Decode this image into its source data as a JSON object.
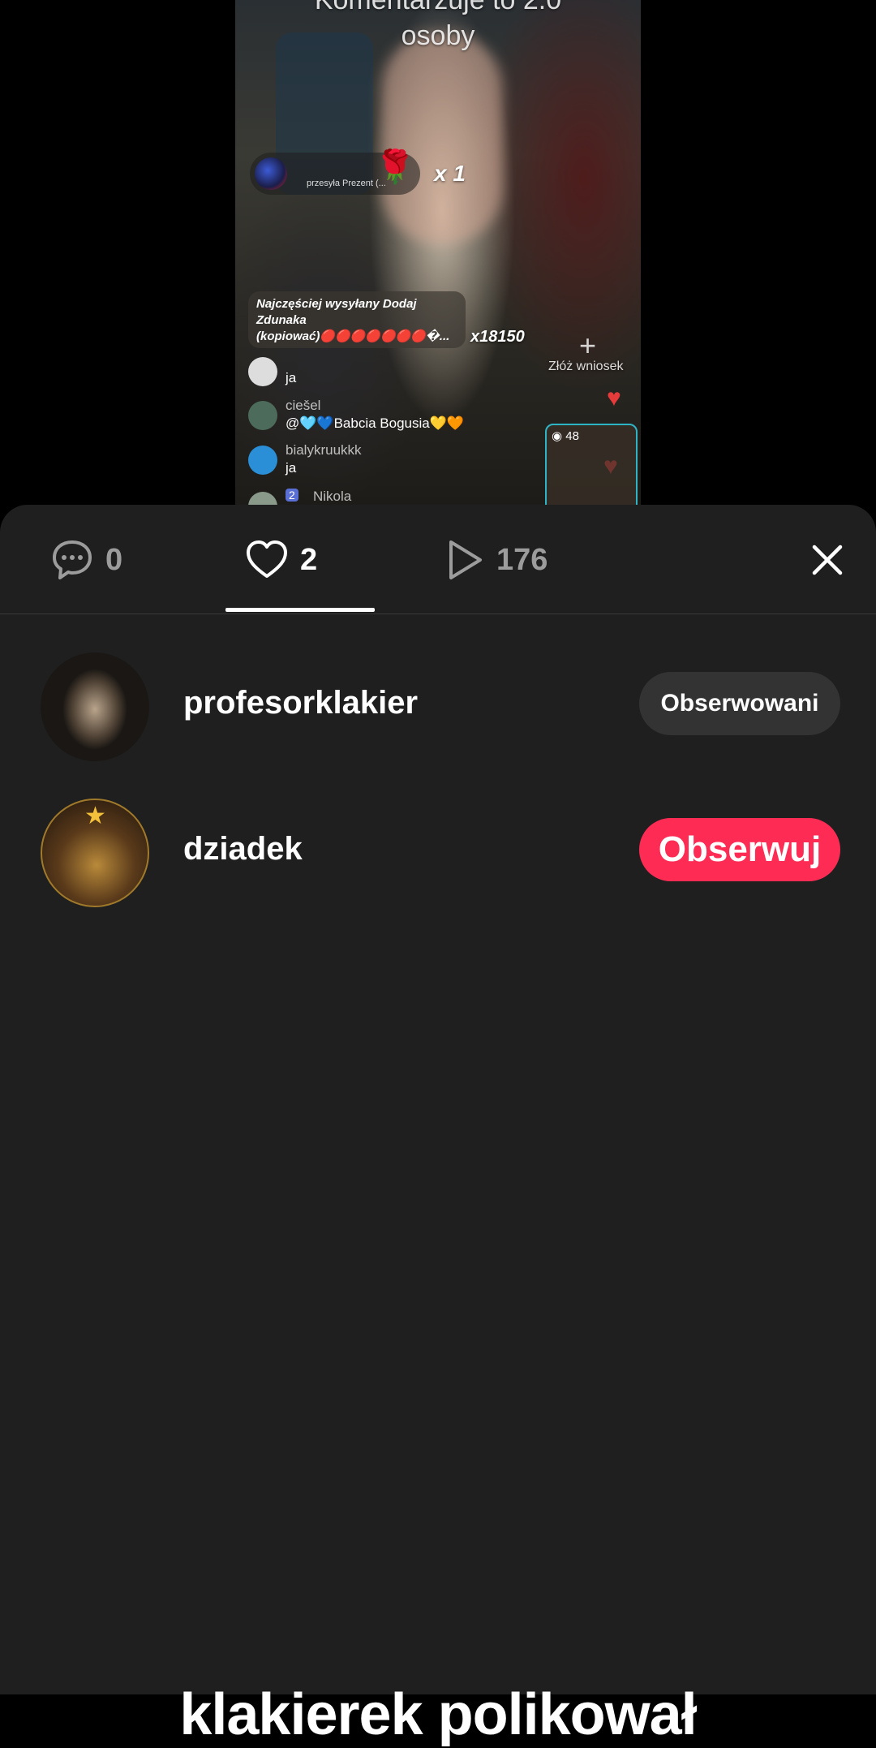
{
  "video": {
    "caption_top": "Komentarzuje to 2.0\nosoby",
    "gift": {
      "text": "przesyła Prezent (...",
      "count": "x 1",
      "rose": "🌹"
    },
    "top_gift": {
      "text": "Najczęściej wysyłany Dodaj Zdunaka (kopiować)🔴🔴🔴🔴🔴🔴🔴�...",
      "count": "x18150"
    },
    "request_label": "Złóż wniosek",
    "chat": [
      {
        "user": "",
        "message": "ja"
      },
      {
        "user": "ciešel",
        "message": "@🩵💙Babcia Bogusia💛🧡"
      },
      {
        "user": "bialykruukkk",
        "message": "ja"
      },
      {
        "user": "Nikola",
        "level": "2",
        "message": ""
      }
    ],
    "mini_player_viewers": "48"
  },
  "tabs": [
    {
      "name": "comments",
      "count": "0"
    },
    {
      "name": "likes",
      "count": "2",
      "active": true
    },
    {
      "name": "views",
      "count": "176"
    }
  ],
  "users": [
    {
      "username": "profesorklakier",
      "button": "Obserwowani",
      "state": "following"
    },
    {
      "username": "dziadek",
      "button": "Obserwuj",
      "state": "not-following"
    }
  ],
  "caption": "klakierek polikował",
  "colors": {
    "sheet_bg": "#1f1f1f",
    "follow_red": "#fe2c55",
    "following_gray": "#333333"
  }
}
